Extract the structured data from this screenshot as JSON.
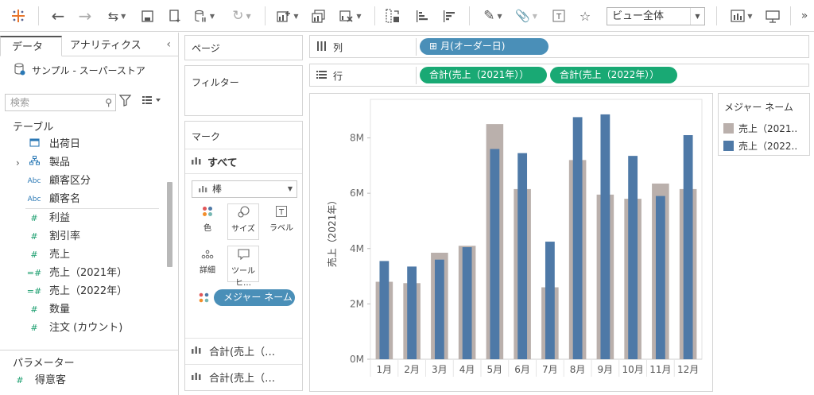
{
  "toolbar": {
    "view_select": "ビュー全体"
  },
  "data_pane": {
    "tab_data": "データ",
    "tab_analytics": "アナリティクス",
    "datasource": "サンプル - スーパーストア",
    "search_placeholder": "検索",
    "tables_heading": "テーブル",
    "fields": [
      {
        "icon": "calendar-icon",
        "label": "出荷日"
      },
      {
        "icon": "hierarchy-icon",
        "label": "製品"
      },
      {
        "icon": "abc-icon",
        "label": "顧客区分"
      },
      {
        "icon": "abc-icon",
        "label": "顧客名"
      },
      {
        "icon": "number-icon",
        "label": "利益"
      },
      {
        "icon": "number-icon",
        "label": "割引率"
      },
      {
        "icon": "number-icon",
        "label": "売上"
      },
      {
        "icon": "calc-number-icon",
        "label": "売上（2021年）"
      },
      {
        "icon": "calc-number-icon",
        "label": "売上（2022年）"
      },
      {
        "icon": "number-icon",
        "label": "数量"
      },
      {
        "icon": "number-icon",
        "label": "注文 (カウント)"
      }
    ],
    "param_heading": "パラメーター",
    "params": [
      {
        "icon": "number-icon",
        "label": "得意客"
      }
    ]
  },
  "cards": {
    "pages": "ページ",
    "filters": "フィルター",
    "marks_title": "マーク",
    "marks_all": "すべて",
    "mark_type": "棒",
    "mark_buttons": [
      "色",
      "サイズ",
      "ラベル",
      "詳細",
      "ツールヒ…"
    ],
    "measure_pill": "メジャー ネーム",
    "sub_marks": [
      "合計(売上（…",
      "合計(売上（…"
    ]
  },
  "shelves": {
    "columns_label": "列",
    "rows_label": "行",
    "column_pill": "月(オーダー日)",
    "row_pills": [
      "合計(売上（2021年））",
      "合計(売上（2022年））"
    ]
  },
  "legend": {
    "title": "メジャー ネーム",
    "items": [
      "売上（2021..",
      "売上（2022.."
    ]
  },
  "colors": {
    "series_2021": "#bab0ac",
    "series_2022": "#4e79a7",
    "pill_blue": "#4a8fb8",
    "pill_green": "#19a974"
  },
  "chart_data": {
    "type": "bar",
    "categories": [
      "1月",
      "2月",
      "3月",
      "4月",
      "5月",
      "6月",
      "7月",
      "8月",
      "9月",
      "10月",
      "11月",
      "12月"
    ],
    "series": [
      {
        "name": "売上（2021..",
        "values": [
          2.8,
          2.75,
          3.85,
          4.1,
          8.5,
          6.15,
          2.6,
          7.2,
          5.95,
          5.8,
          6.35,
          6.15
        ],
        "color": "#bab0ac"
      },
      {
        "name": "売上（2022..",
        "values": [
          3.55,
          3.35,
          3.6,
          4.05,
          7.6,
          7.45,
          4.25,
          8.75,
          8.85,
          7.35,
          5.9,
          8.1
        ],
        "color": "#4e79a7"
      }
    ],
    "ylabel": "売上（2021年）",
    "y_ticks": [
      "0M",
      "2M",
      "4M",
      "6M",
      "8M"
    ],
    "ylim": [
      0,
      9.25
    ],
    "grid": false
  }
}
